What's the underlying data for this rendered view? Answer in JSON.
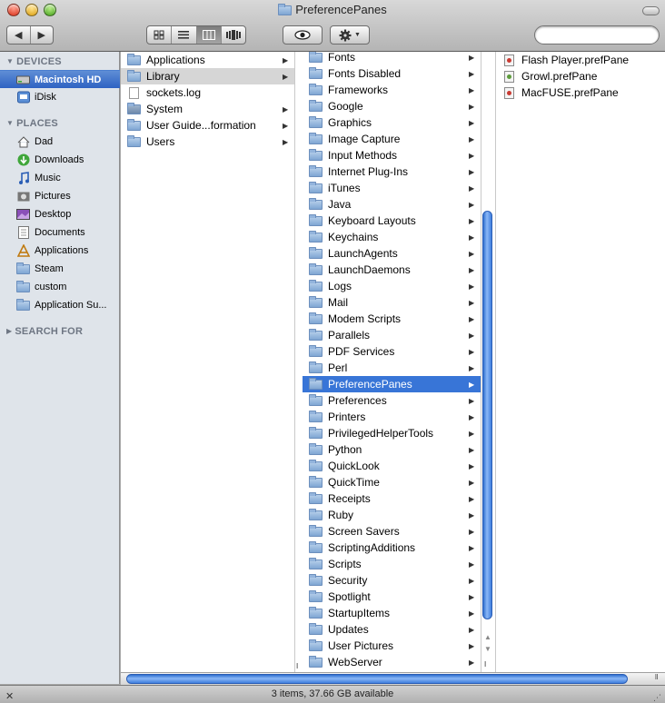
{
  "window": {
    "title": "PreferencePanes"
  },
  "toolbar": {
    "search_placeholder": "",
    "view_modes": [
      "icon",
      "list",
      "column",
      "coverflow"
    ],
    "active_view": "column"
  },
  "sidebar": {
    "sections": [
      {
        "label": "DEVICES"
      },
      {
        "label": "PLACES"
      },
      {
        "label": "SEARCH FOR"
      }
    ],
    "devices": [
      {
        "label": "Macintosh HD",
        "icon": "hard-disk-icon",
        "selected": true
      },
      {
        "label": "iDisk",
        "icon": "idisk-icon"
      }
    ],
    "places": [
      {
        "label": "Dad",
        "icon": "home-icon"
      },
      {
        "label": "Downloads",
        "icon": "downloads-icon"
      },
      {
        "label": "Music",
        "icon": "music-icon"
      },
      {
        "label": "Pictures",
        "icon": "pictures-icon"
      },
      {
        "label": "Desktop",
        "icon": "desktop-icon"
      },
      {
        "label": "Documents",
        "icon": "documents-icon"
      },
      {
        "label": "Applications",
        "icon": "applications-icon"
      },
      {
        "label": "Steam",
        "icon": "folder-icon"
      },
      {
        "label": "custom",
        "icon": "folder-icon"
      },
      {
        "label": "Application Su...",
        "icon": "folder-icon"
      }
    ]
  },
  "column1": {
    "items": [
      {
        "label": "Applications",
        "icon": "folder-icon",
        "has_children": true
      },
      {
        "label": "Library",
        "icon": "folder-icon",
        "has_children": true,
        "selected": true
      },
      {
        "label": "sockets.log",
        "icon": "document-icon",
        "has_children": false
      },
      {
        "label": "System",
        "icon": "system-folder-icon",
        "has_children": true
      },
      {
        "label": "User Guide...formation",
        "icon": "folder-icon",
        "has_children": true
      },
      {
        "label": "Users",
        "icon": "folder-icon",
        "has_children": true
      }
    ]
  },
  "column2": {
    "items": [
      {
        "label": "Fonts"
      },
      {
        "label": "Fonts Disabled"
      },
      {
        "label": "Frameworks"
      },
      {
        "label": "Google"
      },
      {
        "label": "Graphics"
      },
      {
        "label": "Image Capture"
      },
      {
        "label": "Input Methods"
      },
      {
        "label": "Internet Plug-Ins"
      },
      {
        "label": "iTunes"
      },
      {
        "label": "Java"
      },
      {
        "label": "Keyboard Layouts"
      },
      {
        "label": "Keychains"
      },
      {
        "label": "LaunchAgents"
      },
      {
        "label": "LaunchDaemons"
      },
      {
        "label": "Logs"
      },
      {
        "label": "Mail"
      },
      {
        "label": "Modem Scripts"
      },
      {
        "label": "Parallels"
      },
      {
        "label": "PDF Services"
      },
      {
        "label": "Perl"
      },
      {
        "label": "PreferencePanes",
        "selected": true
      },
      {
        "label": "Preferences"
      },
      {
        "label": "Printers"
      },
      {
        "label": "PrivilegedHelperTools"
      },
      {
        "label": "Python"
      },
      {
        "label": "QuickLook"
      },
      {
        "label": "QuickTime"
      },
      {
        "label": "Receipts"
      },
      {
        "label": "Ruby"
      },
      {
        "label": "Screen Savers"
      },
      {
        "label": "ScriptingAdditions"
      },
      {
        "label": "Scripts"
      },
      {
        "label": "Security"
      },
      {
        "label": "Spotlight"
      },
      {
        "label": "StartupItems"
      },
      {
        "label": "Updates"
      },
      {
        "label": "User Pictures"
      },
      {
        "label": "WebServer"
      }
    ]
  },
  "column3": {
    "items": [
      {
        "label": "Flash Player.prefPane",
        "icon": "red-prefpane-icon"
      },
      {
        "label": "Growl.prefPane",
        "icon": "green-prefpane-icon"
      },
      {
        "label": "MacFUSE.prefPane",
        "icon": "red-prefpane-icon"
      }
    ]
  },
  "status": {
    "text": "3 items, 37.66 GB available"
  },
  "colors": {
    "selection_blue": "#3875d7",
    "sidebar_bg": "#dfe4ea",
    "sidebar_selection": "#2e62c3",
    "scroller": "#4f8ae3"
  }
}
